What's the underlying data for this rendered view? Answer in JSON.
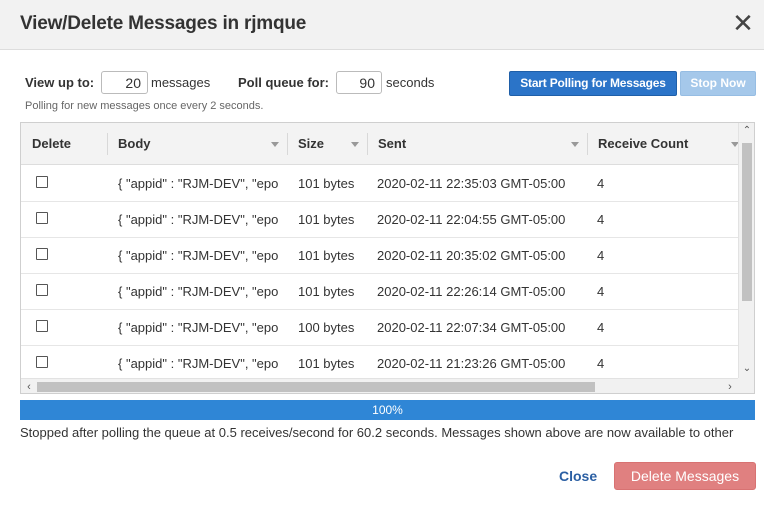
{
  "dialog": {
    "title": "View/Delete Messages in rjmque",
    "close_glyph": "✕"
  },
  "controls": {
    "view_up_to_label": "View up to:",
    "view_up_to_value": "20",
    "messages_label": "messages",
    "poll_queue_label": "Poll queue for:",
    "poll_queue_value": "90",
    "seconds_label": "seconds",
    "start_polling_label": "Start Polling for Messages",
    "stop_now_label": "Stop Now",
    "hint": "Polling for new messages once every 2 seconds."
  },
  "table": {
    "columns": [
      "Delete",
      "Body",
      "Size",
      "Sent",
      "Receive Count"
    ],
    "rows": [
      {
        "body": "{ \"appid\" : \"RJM-DEV\", \"epo",
        "size": "101 bytes",
        "sent": "2020-02-11 22:35:03 GMT-05:00",
        "count": "4"
      },
      {
        "body": "{ \"appid\" : \"RJM-DEV\", \"epo",
        "size": "101 bytes",
        "sent": "2020-02-11 22:04:55 GMT-05:00",
        "count": "4"
      },
      {
        "body": "{ \"appid\" : \"RJM-DEV\", \"epo",
        "size": "101 bytes",
        "sent": "2020-02-11 20:35:02 GMT-05:00",
        "count": "4"
      },
      {
        "body": "{ \"appid\" : \"RJM-DEV\", \"epo",
        "size": "101 bytes",
        "sent": "2020-02-11 22:26:14 GMT-05:00",
        "count": "4"
      },
      {
        "body": "{ \"appid\" : \"RJM-DEV\", \"epo",
        "size": "100 bytes",
        "sent": "2020-02-11 22:07:34 GMT-05:00",
        "count": "4"
      },
      {
        "body": "{ \"appid\" : \"RJM-DEV\", \"epo",
        "size": "101 bytes",
        "sent": "2020-02-11 21:23:26 GMT-05:00",
        "count": "4"
      }
    ]
  },
  "progress": {
    "percent": 100,
    "label": "100%"
  },
  "status": "Stopped after polling the queue at 0.5 receives/second for 60.2 seconds. Messages shown above are now available to other",
  "footer": {
    "close_label": "Close",
    "delete_label": "Delete Messages"
  },
  "colors": {
    "primary": "#2b74c8",
    "progress": "#2f86d6",
    "danger": "#e08080",
    "link": "#2b5fa3"
  }
}
